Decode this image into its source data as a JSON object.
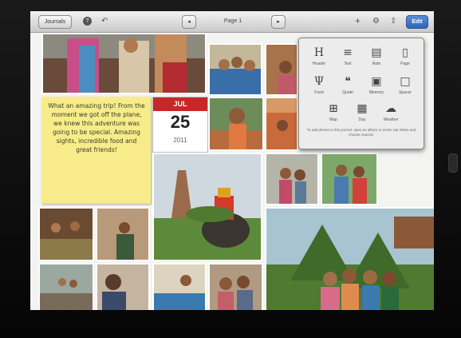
{
  "toolbar": {
    "journals_label": "Journals",
    "page_label": "Page 1",
    "edit_label": "Edit",
    "prev_icon": "chevron-left-icon",
    "next_icon": "chevron-right-icon",
    "help_icon": "question-icon",
    "undo_icon": "undo-icon",
    "add_icon": "plus-icon",
    "settings_icon": "gear-icon",
    "share_icon": "share-icon"
  },
  "note": {
    "text": "What an amazing trip! From the moment we got off the plane, we knew this adventure was going to be special. Amazing sights, incredible food and great friends!"
  },
  "calendar": {
    "month": "JUL",
    "day": "25",
    "year": "2011"
  },
  "insert_menu": {
    "items": [
      {
        "label": "Header",
        "icon": "header-icon",
        "glyph": "H"
      },
      {
        "label": "Text",
        "icon": "text-icon",
        "glyph": "≡"
      },
      {
        "label": "Note",
        "icon": "note-icon",
        "glyph": "▤"
      },
      {
        "label": "Page",
        "icon": "page-icon",
        "glyph": "▯"
      },
      {
        "label": "Food",
        "icon": "food-icon",
        "glyph": "Ψ"
      },
      {
        "label": "Quote",
        "icon": "quote-icon",
        "glyph": "❝"
      },
      {
        "label": "Memory",
        "icon": "memory-icon",
        "glyph": "▣"
      },
      {
        "label": "Spacer",
        "icon": "spacer-icon",
        "glyph": "□"
      },
      {
        "label": "Map",
        "icon": "map-icon",
        "glyph": "⊞"
      },
      {
        "label": "Day",
        "icon": "day-icon",
        "glyph": "▦"
      },
      {
        "label": "Weather",
        "icon": "weather-icon",
        "glyph": "☁"
      }
    ],
    "hint": "To add photos to this journal, open an album or event, tap Share and choose Journal."
  },
  "colors": {
    "accent": "#2f63b4",
    "calendar_red": "#c62828",
    "note_yellow": "#f8ec8a"
  }
}
